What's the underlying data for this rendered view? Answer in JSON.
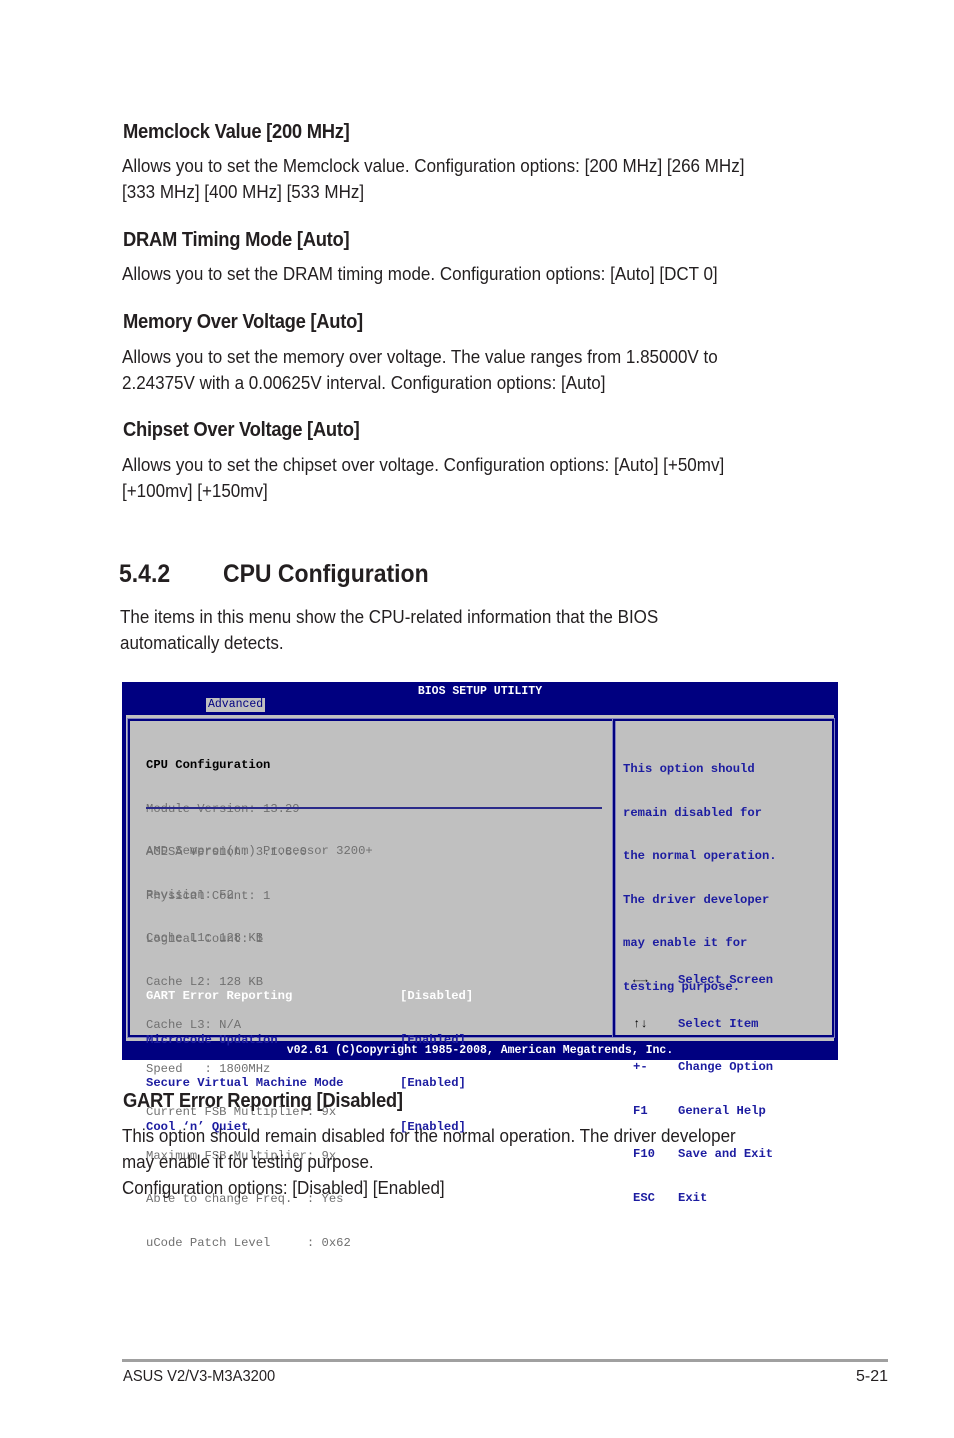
{
  "sections": [
    {
      "heading": "Memclock Value [200 MHz]",
      "lines": [
        "Allows you to set the Memclock value. Configuration options: [200 MHz] [266 MHz]",
        "[333 MHz] [400 MHz] [533 MHz]"
      ]
    },
    {
      "heading": "DRAM Timing Mode [Auto]",
      "lines": [
        "Allows you to set the DRAM timing mode. Configuration options: [Auto] [DCT 0]"
      ]
    },
    {
      "heading": "Memory Over Voltage [Auto]",
      "lines": [
        "Allows you to set the memory over voltage. The value ranges from 1.85000V to",
        "2.24375V with a 0.00625V interval. Configuration options: [Auto]"
      ]
    },
    {
      "heading": "Chipset Over Voltage [Auto]",
      "lines": [
        "Allows you to set the chipset over voltage. Configuration options: [Auto] [+50mv]",
        "[+100mv] [+150mv]"
      ]
    }
  ],
  "cpu_section": {
    "number": "5.4.2",
    "title": "CPU Configuration",
    "intro": [
      "The items in this menu show the CPU-related information that the BIOS",
      "automatically detects."
    ]
  },
  "bios": {
    "title": "BIOS SETUP UTILITY",
    "active_tab": "Advanced",
    "panel_title": "CPU Configuration",
    "info1": [
      "Module Version: 13.29",
      "AGESA Version: 3.1.8.0",
      "Physical Count: 1",
      "Logical Count: 1"
    ],
    "info2": [
      "AMD Sempron(tm) Processor 3200+",
      "Revision: F2",
      "Cache L1: 128 KB",
      "Cache L2: 128 KB",
      "Cache L3: N/A",
      "Speed   : 1800MHz",
      "Current FSB Multiplier: 9x",
      "Maximum FSB Multiplier: 9x",
      "Able to change Freq.  : Yes",
      "uCode Patch Level     : 0x62"
    ],
    "options": [
      {
        "label": "GART Error Reporting",
        "value": "[Disabled]",
        "selected": true
      },
      {
        "label": "Microcode Updation",
        "value": "[Enabled]",
        "selected": false
      },
      {
        "label": "Secure Virtual Machine Mode",
        "value": "[Enabled]",
        "selected": false
      },
      {
        "label": "Cool ‘n’ Quiet",
        "value": "[Enabled]",
        "selected": false
      }
    ],
    "help": [
      "This option should",
      "remain disabled for",
      "the normal operation.",
      "The driver developer",
      "may enable it for",
      "testing purpose."
    ],
    "keys": [
      {
        "key": "←→",
        "action": "Select Screen"
      },
      {
        "key": "↑↓",
        "action": "Select Item"
      },
      {
        "key": "+-",
        "action": "Change Option"
      },
      {
        "key": "F1",
        "action": "General Help"
      },
      {
        "key": "F10",
        "action": "Save and Exit"
      },
      {
        "key": "ESC",
        "action": "Exit"
      }
    ],
    "footer": "v02.61 (C)Copyright 1985-2008, American Megatrends, Inc."
  },
  "gart_section": {
    "heading": "GART Error Reporting [Disabled]",
    "lines": [
      "This option should remain disabled for the normal operation. The driver developer",
      "may enable it for testing purpose.",
      "Configuration options: [Disabled] [Enabled]"
    ]
  },
  "footer": {
    "product": "ASUS V2/V3-M3A3200",
    "page": "5-21"
  }
}
